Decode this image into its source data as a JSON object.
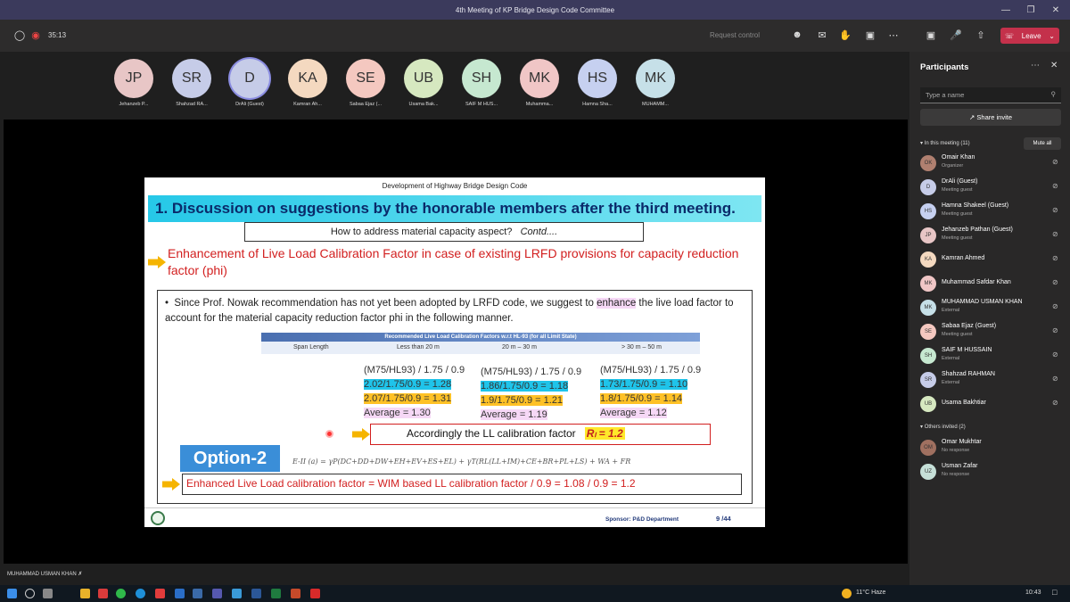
{
  "window": {
    "title": "4th Meeting of KP Bridge Design Code Committee"
  },
  "toolbar": {
    "timer": "35:13",
    "request_control": "Request control",
    "leave_label": "Leave",
    "leave_color": "#c4314b"
  },
  "gallery": [
    {
      "initials": "JP",
      "name": "Jehanzeb P...",
      "color": "#e8c6c6"
    },
    {
      "initials": "SR",
      "name": "Shahzad RA...",
      "color": "#c6cce8"
    },
    {
      "initials": "D",
      "name": "DrAli (Guest)",
      "color": "#c6cce8"
    },
    {
      "initials": "KA",
      "name": "Kamran Ah...",
      "color": "#f4d9c0"
    },
    {
      "initials": "SE",
      "name": "Sabaa Ejaz (...",
      "color": "#f4c8c0"
    },
    {
      "initials": "UB",
      "name": "Usama Bak...",
      "color": "#d6e8c0"
    },
    {
      "initials": "SH",
      "name": "SAIF M HUS...",
      "color": "#c6e8d0"
    },
    {
      "initials": "MK",
      "name": "Muhamma...",
      "color": "#f0c6c6"
    },
    {
      "initials": "HS",
      "name": "Hamna Sha...",
      "color": "#c6d0f0"
    },
    {
      "initials": "MK",
      "name": "MUHAMM...",
      "color": "#c6e0e8"
    }
  ],
  "slide": {
    "header": "Development of Highway Bridge Design Code",
    "title": "1. Discussion on suggestions by the honorable members after the third meeting.",
    "question": "How to address material capacity aspect?",
    "question_contd": "Contd....",
    "red_heading": "Enhancement of Live Load Calibration Factor in case of existing LRFD provisions for capacity reduction factor (phi)",
    "bullet_part1": "Since Prof. Nowak recommendation has not yet been adopted by LRFD code, we suggest to ",
    "bullet_enhance": "enhance",
    "bullet_part2": " the live load factor to account for the material capacity reduction factor phi in the following manner.",
    "table_title": "Recommended Live Load Calibration Factors w.r.t HL-93 (for all Limit State)",
    "table_cols": [
      "Span Length",
      "Less than 20 m",
      "20 m – 30 m",
      "> 30 m – 50 m"
    ],
    "calc_cols": [
      {
        "head": "(M75/HL93) / 1.75 / 0.9",
        "line1": "2.02/1.75/0.9 = 1.28",
        "line2": "2.07/1.75/0.9 = 1.31",
        "avg": "Average = 1.30"
      },
      {
        "head": "(M75/HL93) / 1.75 / 0.9",
        "line1": "1.86/1.75/0.9 = 1.18",
        "line2": "1.9/1.75/0.9  = 1.21",
        "avg": "Average = 1.19"
      },
      {
        "head": "(M75/HL93) / 1.75 / 0.9",
        "line1": "1.73/1.75/0.9 = 1.10",
        "line2": "1.8/1.75/0.9   = 1.14",
        "avg": "Average = 1.12"
      }
    ],
    "ll_text": "Accordingly the LL calibration factor",
    "ll_value": "Rₗ = 1.2",
    "option": "Option-2",
    "formula": "E-II (a) = γP(DC+DD+DW+EH+EV+ES+EL) + γT(RL(LL+IM)+CE+BR+PL+LS) + WA + FR",
    "enhanced_text": "Enhanced Live Load calibration factor = WIM based LL calibration factor /  0.9 = 1.08 / 0.9 = 1.2",
    "sponsor": "Sponsor: P&D Department",
    "page": "9 /44"
  },
  "presenter_name": "MUHAMMAD USMAN KHAN",
  "panel": {
    "title": "Participants",
    "search_placeholder": "Type a name",
    "share_invite": "Share invite",
    "in_meeting": "In this meeting (11)",
    "mute_all": "Mute all",
    "participants": [
      {
        "initials": "OK",
        "name": "Omair Khan",
        "role": "Organizer",
        "color": "#b08070"
      },
      {
        "initials": "D",
        "name": "DrAli (Guest)",
        "role": "Meeting guest",
        "color": "#c6cce8"
      },
      {
        "initials": "HS",
        "name": "Hamna Shakeel (Guest)",
        "role": "Meeting guest",
        "color": "#c6d0f0"
      },
      {
        "initials": "JP",
        "name": "Jehanzeb Pathan (Guest)",
        "role": "Meeting guest",
        "color": "#e8c6c6"
      },
      {
        "initials": "KA",
        "name": "Kamran Ahmed",
        "role": "",
        "color": "#f4d9c0"
      },
      {
        "initials": "MK",
        "name": "Muhammad Safdar Khan",
        "role": "",
        "color": "#f0c6c6"
      },
      {
        "initials": "MK",
        "name": "MUHAMMAD USMAN KHAN",
        "role": "External",
        "color": "#c6e0e8"
      },
      {
        "initials": "SE",
        "name": "Sabaa Ejaz (Guest)",
        "role": "Meeting guest",
        "color": "#f4c8c0"
      },
      {
        "initials": "SH",
        "name": "SAIF M HUSSAIN",
        "role": "External",
        "color": "#c6e8d0"
      },
      {
        "initials": "SR",
        "name": "Shahzad RAHMAN",
        "role": "External",
        "color": "#c6cce8"
      },
      {
        "initials": "UB",
        "name": "Usama Bakhtiar",
        "role": "",
        "color": "#d6e8c0"
      }
    ],
    "others_invited": "Others invited (2)",
    "invited": [
      {
        "initials": "OM",
        "name": "Omar Mukhtar",
        "role": "No response",
        "color": "#a07060"
      },
      {
        "initials": "UZ",
        "name": "Usman Zafar",
        "role": "No response",
        "color": "#c6e0d8"
      }
    ]
  },
  "taskbar": {
    "weather": "11°C  Haze",
    "time": "10:43"
  }
}
